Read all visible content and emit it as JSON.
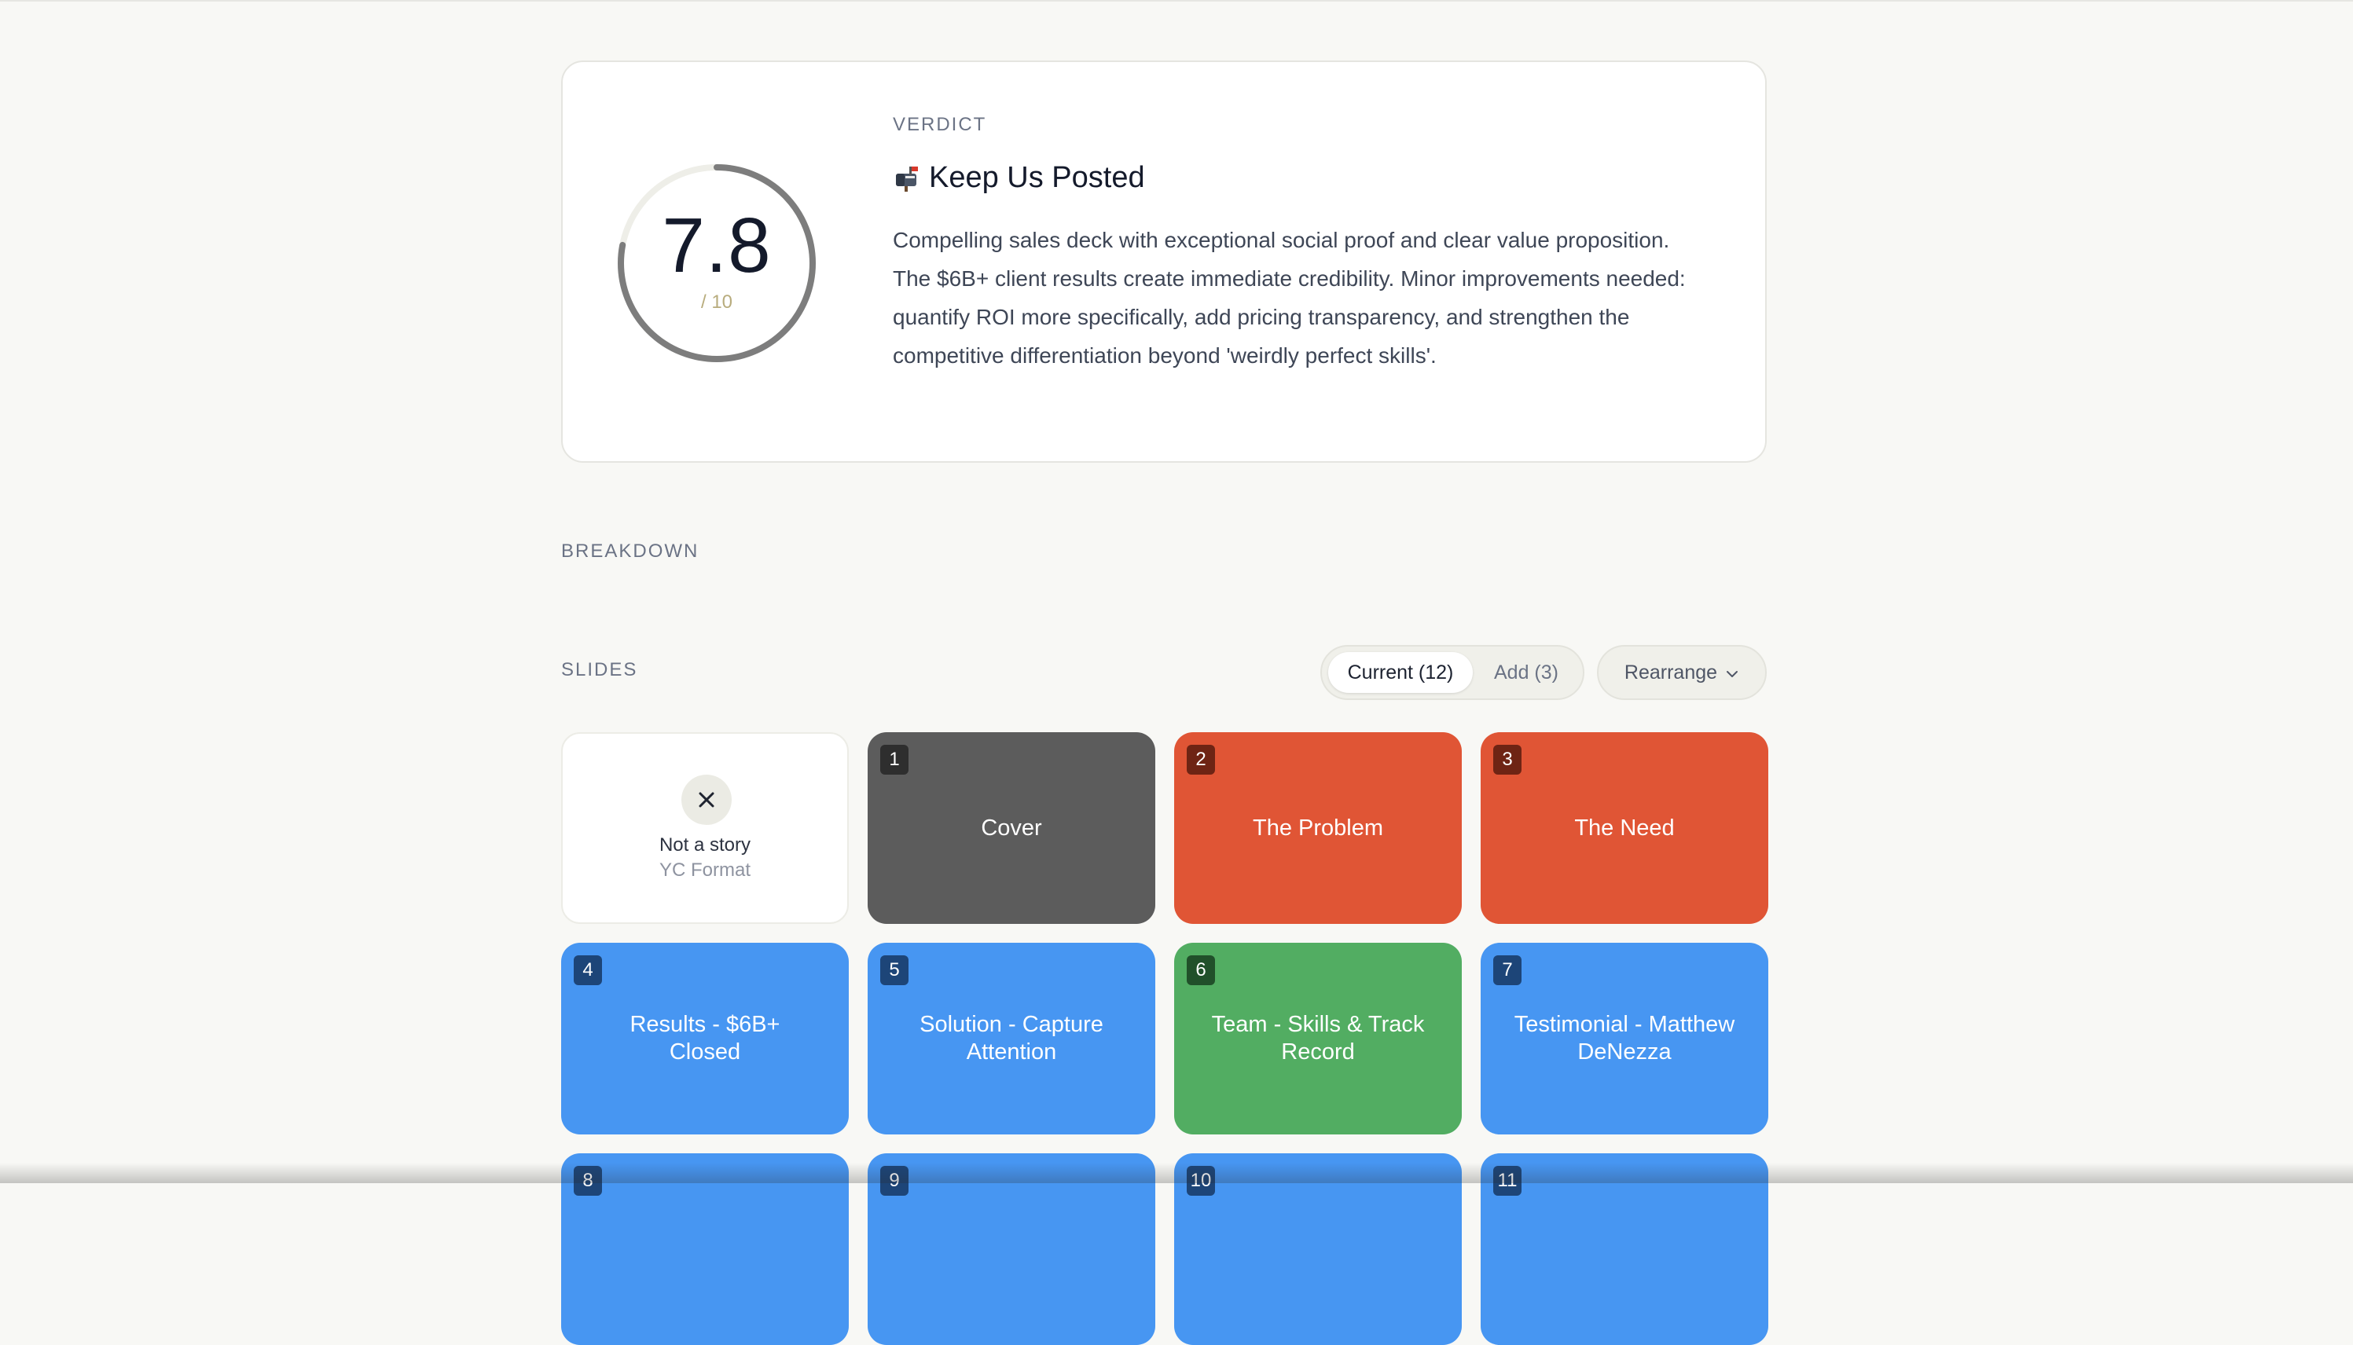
{
  "verdict": {
    "label": "VERDICT",
    "score": "7.8",
    "score_max": "/ 10",
    "score_fraction": 0.78,
    "title": "Keep Us Posted",
    "icon": "mailbox-icon",
    "text": "Compelling sales deck with exceptional social proof and clear value proposition. The $6B+ client results create immediate credibility. Minor improvements needed: quantify ROI more specifically, add pricing transparency, and strengthen the competitive differentiation beyond 'weirdly perfect skills'."
  },
  "breakdown": {
    "label": "BREAKDOWN"
  },
  "slides_section": {
    "label": "SLIDES",
    "toggle": {
      "current": "Current (12)",
      "add": "Add (3)"
    },
    "rearrange": "Rearrange",
    "story_card": {
      "title": "Not a story",
      "subtitle": "YC Format"
    },
    "slides": [
      {
        "num": "1",
        "title": "Cover",
        "color": "gray"
      },
      {
        "num": "2",
        "title": "The Problem",
        "color": "red"
      },
      {
        "num": "3",
        "title": "The Need",
        "color": "red"
      },
      {
        "num": "4",
        "title": "Results - $6B+ Closed",
        "color": "blue"
      },
      {
        "num": "5",
        "title": "Solution - Capture Attention",
        "color": "blue"
      },
      {
        "num": "6",
        "title": "Team - Skills & Track Record",
        "color": "green"
      },
      {
        "num": "7",
        "title": "Testimonial - Matthew DeNezza",
        "color": "blue"
      },
      {
        "num": "8",
        "title": "",
        "color": "blue"
      },
      {
        "num": "9",
        "title": "",
        "color": "blue"
      },
      {
        "num": "10",
        "title": "",
        "color": "blue"
      },
      {
        "num": "11",
        "title": "",
        "color": "blue"
      }
    ]
  },
  "colors": {
    "gray": "#5c5c5c",
    "red": "#e05535",
    "blue": "#4796f2",
    "green": "#52ad62",
    "ring": "#7d7d7d",
    "ring_track": "#eeeee8"
  }
}
